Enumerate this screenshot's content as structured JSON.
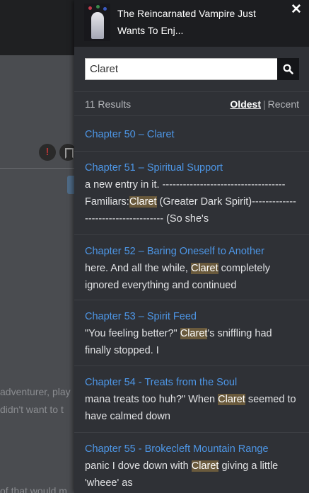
{
  "background_page": {
    "line1": "adventurer, play",
    "line2": "didn't want to t",
    "line3": "of that would m"
  },
  "drawer": {
    "novel_title": "The Reincarnated Vampire Just Wants To Enj...",
    "close_icon": "close-icon",
    "search": {
      "value": "Claret",
      "button_icon": "search-icon"
    },
    "results_count": "11 Results",
    "sort": {
      "oldest": "Oldest",
      "separator": "|",
      "recent": "Recent"
    },
    "results": [
      {
        "title": "Chapter 50 – Claret",
        "before": "",
        "match": "",
        "after": ""
      },
      {
        "title": "Chapter 51 – Spiritual Support",
        "before": "a new entry in it. ------------------------------------ Familiars:",
        "match": "Claret",
        "after": " (Greater Dark Spirit)------------------------------------ (So she's"
      },
      {
        "title": "Chapter 52 – Baring Oneself to Another",
        "before": "here. And all the while, ",
        "match": "Claret",
        "after": " completely ignored everything and continued"
      },
      {
        "title": "Chapter 53 – Spirit Feed",
        "before": "\"You feeling better?\" ",
        "match": "Claret",
        "after": "'s sniffling had finally stopped. I"
      },
      {
        "title": "Chapter 54 - Treats from the Soul",
        "before": "mana treats too huh?\" When ",
        "match": "Claret",
        "after": " seemed to have calmed down"
      },
      {
        "title": "Chapter 55 - Brokecleft Mountain Range",
        "before": "panic I dove down with ",
        "match": "Claret",
        "after": " giving a little 'wheee' as"
      }
    ]
  }
}
